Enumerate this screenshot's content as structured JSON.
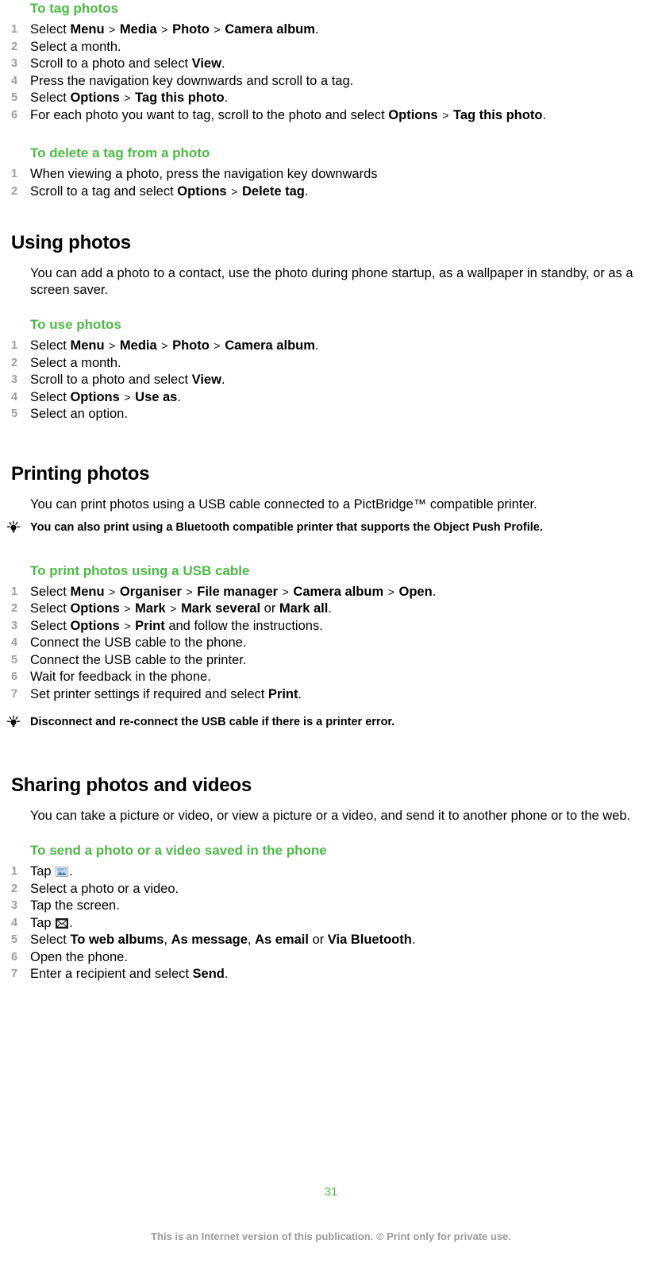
{
  "document": {
    "page_number": "31",
    "footer_note": "This is an Internet version of this publication. © Print only for private use.",
    "accent_green": "#4cb944",
    "step_number_gray": "#9d9d9d",
    "footer_gray": "#9b9b9b"
  },
  "procedures": {
    "tag_photos": {
      "title": "To tag photos",
      "steps": [
        "Select <b>Menu</b> <span class=\"gt\">&gt;</span> <b>Media</b> <span class=\"gt\">&gt;</span> <b>Photo</b> <span class=\"gt\">&gt;</span> <b>Camera album</b>.",
        "Select a month.",
        "Scroll to a photo and select <b>View</b>.",
        "Press the navigation key downwards and scroll to a tag.",
        "Select <b>Options</b> <span class=\"gt\">&gt;</span> <b>Tag this photo</b>.",
        "For each photo you want to tag, scroll to the photo and select <b>Options</b> <span class=\"gt\">&gt;</span> <b>Tag this photo</b>."
      ]
    },
    "delete_tag": {
      "title": "To delete a tag from a photo",
      "steps": [
        "When viewing a photo, press the navigation key downwards",
        "Scroll to a tag and select <b>Options</b> <span class=\"gt\">&gt;</span> <b>Delete tag</b>."
      ]
    },
    "use_photos": {
      "title": "To use photos",
      "steps": [
        "Select <b>Menu</b> <span class=\"gt\">&gt;</span> <b>Media</b> <span class=\"gt\">&gt;</span> <b>Photo</b> <span class=\"gt\">&gt;</span> <b>Camera album</b>.",
        "Select a month.",
        "Scroll to a photo and select <b>View</b>.",
        "Select <b>Options</b> <span class=\"gt\">&gt;</span> <b>Use as</b>.",
        "Select an option."
      ]
    },
    "print_usb": {
      "title": "To print photos using a USB cable",
      "steps": [
        "Select <b>Menu</b> <span class=\"gt\">&gt;</span> <b>Organiser</b> <span class=\"gt\">&gt;</span> <b>File manager</b> <span class=\"gt\">&gt;</span> <b>Camera album</b> <span class=\"gt\">&gt;</span> <b>Open</b>.",
        "Select <b>Options</b> <span class=\"gt\">&gt;</span> <b>Mark</b> <span class=\"gt\">&gt;</span> <b>Mark several</b> or <b>Mark all</b>.",
        "Select <b>Options</b> <span class=\"gt\">&gt;</span> <b>Print</b> and follow the instructions.",
        "Connect the USB cable to the phone.",
        "Connect the USB cable to the printer.",
        "Wait for feedback in the phone.",
        "Set printer settings if required and select <b>Print</b>."
      ]
    },
    "send_photo_video": {
      "title": "To send a photo or a video saved in the phone",
      "steps": [
        "Tap <span class=\"slot-picture\"></span>.",
        "Select a photo or a video.",
        "Tap the screen.",
        "Tap <span class=\"slot-envelope\"></span>.",
        "Select <b>To web albums</b>, <b>As message</b>, <b>As email</b> or <b>Via Bluetooth</b>.",
        "Open the phone.",
        "Enter a recipient and select <b>Send</b>."
      ]
    }
  },
  "sections": {
    "using_photos": {
      "heading": "Using photos",
      "body": "You can add a photo to a contact, use the photo during phone startup, as a wallpaper in standby, or as a screen saver."
    },
    "printing_photos": {
      "heading": "Printing photos",
      "body": "You can print photos using a USB cable connected to a PictBridge™ compatible printer.",
      "tip": "You can also print using a Bluetooth compatible printer that supports the Object Push Profile."
    },
    "printing_tip_2": {
      "tip": "Disconnect and re-connect the USB cable if there is a printer error."
    },
    "sharing": {
      "heading": "Sharing photos and videos",
      "body": "You can take a picture or video, or view a picture or a video, and send it to another phone or to the web."
    }
  },
  "icons": {
    "tip_bulb": "lightbulb-icon",
    "picture": "picture-icon",
    "envelope": "envelope-icon"
  }
}
